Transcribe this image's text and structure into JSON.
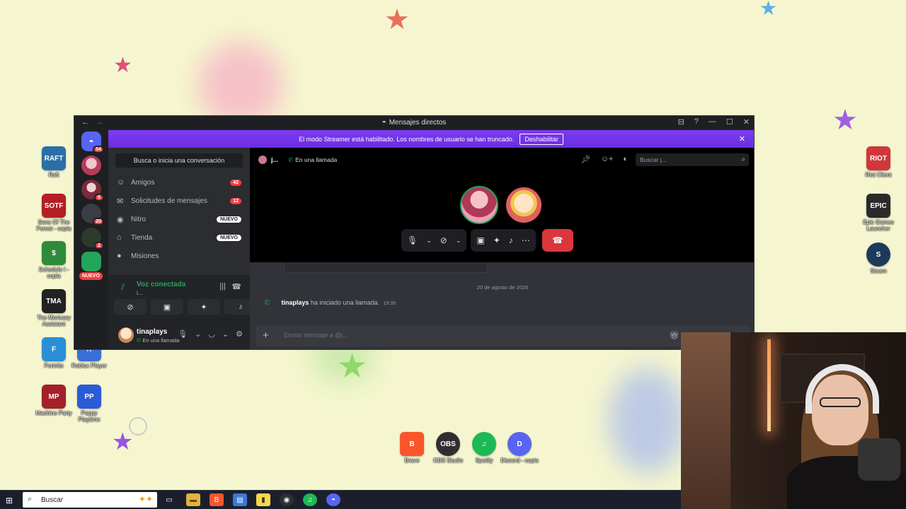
{
  "colors": {
    "desktop_bg": "#f5f6cf",
    "discord_bg": "#1e1f22",
    "banner": "#7d3cf0",
    "online_green": "#23a55a",
    "danger_red": "#da373c",
    "badge_red": "#f23f43"
  },
  "desktop": {
    "left_icons": [
      {
        "label": "Raft",
        "tile": "RAFT",
        "color": "#2b6fa8"
      },
      {
        "label": "Sons Of The Forest - copia",
        "tile": "SOTF",
        "color": "#b31f24"
      },
      {
        "label": "Schedule I - copia",
        "tile": "$",
        "color": "#2e8b3a"
      },
      {
        "label": "The Mortuary Assistant",
        "tile": "TMA",
        "color": "#222222"
      },
      {
        "label": "Fortnite",
        "tile": "F",
        "color": "#2a8fd6"
      },
      {
        "label": "Roblox Player",
        "tile": "R",
        "color": "#3a6fd8"
      },
      {
        "label": "Machine Party",
        "tile": "MP",
        "color": "#a3202a"
      },
      {
        "label": "Poppy Playtime",
        "tile": "PP",
        "color": "#2a5bd8"
      }
    ],
    "right_icons": [
      {
        "label": "Riot Client",
        "tile": "RIOT",
        "color": "#d13639"
      },
      {
        "label": "Epic Games Launcher",
        "tile": "EPIC",
        "color": "#2a2a2a"
      },
      {
        "label": "Steam",
        "tile": "S",
        "color": "#1b3a5c"
      }
    ],
    "bottom_icons": [
      {
        "label": "Brave",
        "tile": "B",
        "color": "#fb542b"
      },
      {
        "label": "OBS Studio",
        "tile": "OBS",
        "color": "#302e31"
      },
      {
        "label": "Spotify",
        "tile": "♫",
        "color": "#1db954"
      },
      {
        "label": "Discord - copia",
        "tile": "D",
        "color": "#5865f2"
      }
    ]
  },
  "discord": {
    "window_title": "Mensajes directos",
    "nav_back": "←",
    "nav_forward": "→",
    "window_controls": [
      "⊟",
      "?",
      "—",
      "☐",
      "✕"
    ],
    "banner": {
      "text": "El modo Streamer está habilitado. Los nombres de usuario se han truncado.",
      "button": "Deshabilitar",
      "close": "✕"
    },
    "rail": {
      "badges": [
        "54",
        "5",
        "20",
        "2"
      ],
      "new_pill": "NUEVO"
    },
    "sidebar": {
      "search_label": "Busca o inicia una conversación",
      "items": [
        {
          "label": "Amigos",
          "icon": "friends-icon",
          "glyph": "☺",
          "badge": "42"
        },
        {
          "label": "Solicitudes de mensajes",
          "icon": "mail-icon",
          "glyph": "✉",
          "badge": "12"
        },
        {
          "label": "Nitro",
          "icon": "nitro-icon",
          "glyph": "◉",
          "tag": "NUEVO"
        },
        {
          "label": "Tienda",
          "icon": "shop-icon",
          "glyph": "⌂",
          "tag": "NUEVO"
        },
        {
          "label": "Misiones",
          "icon": "quests-icon",
          "glyph": "●"
        }
      ]
    },
    "voice": {
      "title": "Voz conectada",
      "subtitle": "i..."
    },
    "user": {
      "name": "tinaplays",
      "status": "En una llamada"
    },
    "dm": {
      "name": "j...",
      "call_status": "En una llamada",
      "search_placeholder": "Buscar j..."
    },
    "messages": {
      "date_separator": "20 de agosto de 2026",
      "system_user": "tinaplays",
      "system_text": "ha iniciado una llamada.",
      "system_time": "19:39"
    },
    "composer": {
      "placeholder": "Enviar mensaje a @j..."
    }
  },
  "taskbar": {
    "search_label": "Buscar"
  }
}
